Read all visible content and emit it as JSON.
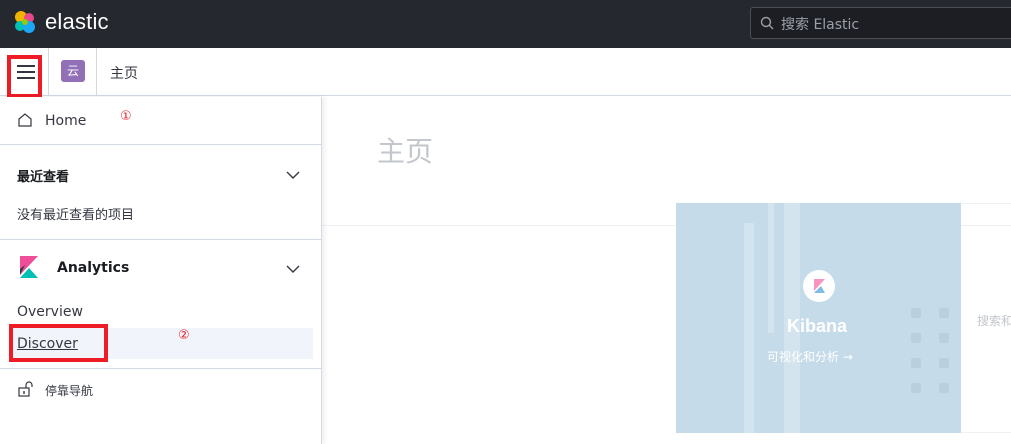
{
  "header": {
    "brand": "elastic",
    "search_placeholder": "搜索 Elastic"
  },
  "secondary": {
    "space_initial": "云",
    "breadcrumb": "主页"
  },
  "nav": {
    "home_label": "Home",
    "recent_title": "最近查看",
    "recent_empty": "没有最近查看的项目",
    "analytics_title": "Analytics",
    "items": [
      "Overview",
      "Discover"
    ],
    "dock_label": "停靠导航"
  },
  "annotations": {
    "marker1": "①",
    "marker2": "②",
    "highlight_color": "#ee1c25"
  },
  "main": {
    "page_title": "主页",
    "kibana_title": "Kibana",
    "kibana_subtitle": "可视化和分析 →",
    "search_hint": "搜索和"
  },
  "colors": {
    "header_bg": "#25282f",
    "space_badge": "#9170b8",
    "kibana_card": "#c5dbea"
  }
}
